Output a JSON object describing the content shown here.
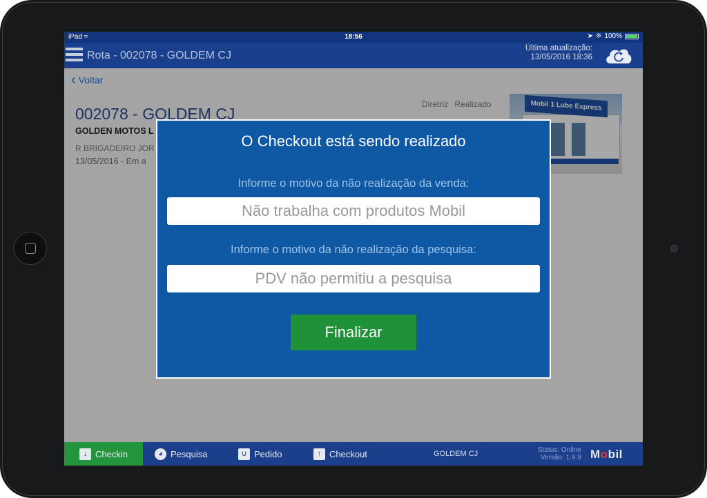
{
  "status_bar": {
    "carrier": "iPad",
    "time": "18:56",
    "battery": "100%"
  },
  "nav": {
    "title": "Rota - 002078 - GOLDEM CJ",
    "last_update_label": "Última atualização:",
    "last_update_value": "13/05/2016 18:36"
  },
  "back_label": "Voltar",
  "client": {
    "code_name": "002078 - GOLDEM CJ",
    "company": "GOLDEN MOTOS L",
    "address": "R BRIGADEIRO JOR",
    "date": "13/05/2016 - Em a",
    "columns": [
      "Diretriz",
      "Realizado"
    ]
  },
  "modal": {
    "title": "O Checkout está sendo realizado",
    "sale_label": "Informe o motivo da não realização da venda:",
    "sale_value": "Não trabalha com produtos Mobil",
    "survey_label": "Informe o motivo da não realização da pesquisa:",
    "survey_value": "PDV não permitiu a pesquisa",
    "finish_label": "Finalizar"
  },
  "tabs": [
    {
      "label": "Checkin",
      "icon": "checkin-icon",
      "active": true
    },
    {
      "label": "Pesquisa",
      "icon": "pie-chart-icon",
      "active": false
    },
    {
      "label": "Pedido",
      "icon": "bag-icon",
      "active": false
    },
    {
      "label": "Checkout",
      "icon": "upload-icon",
      "active": false
    }
  ],
  "footer": {
    "client": "GOLDEM CJ",
    "status": "Status: Online",
    "version": "Versão: 1.9.9",
    "brand": "Mobil"
  },
  "store_sign": "Mobil 1 Lube Express",
  "colors": {
    "nav": "#1a3f8d",
    "modal": "#0f58a4",
    "finish": "#1f9139",
    "active_tab": "#24953d"
  }
}
